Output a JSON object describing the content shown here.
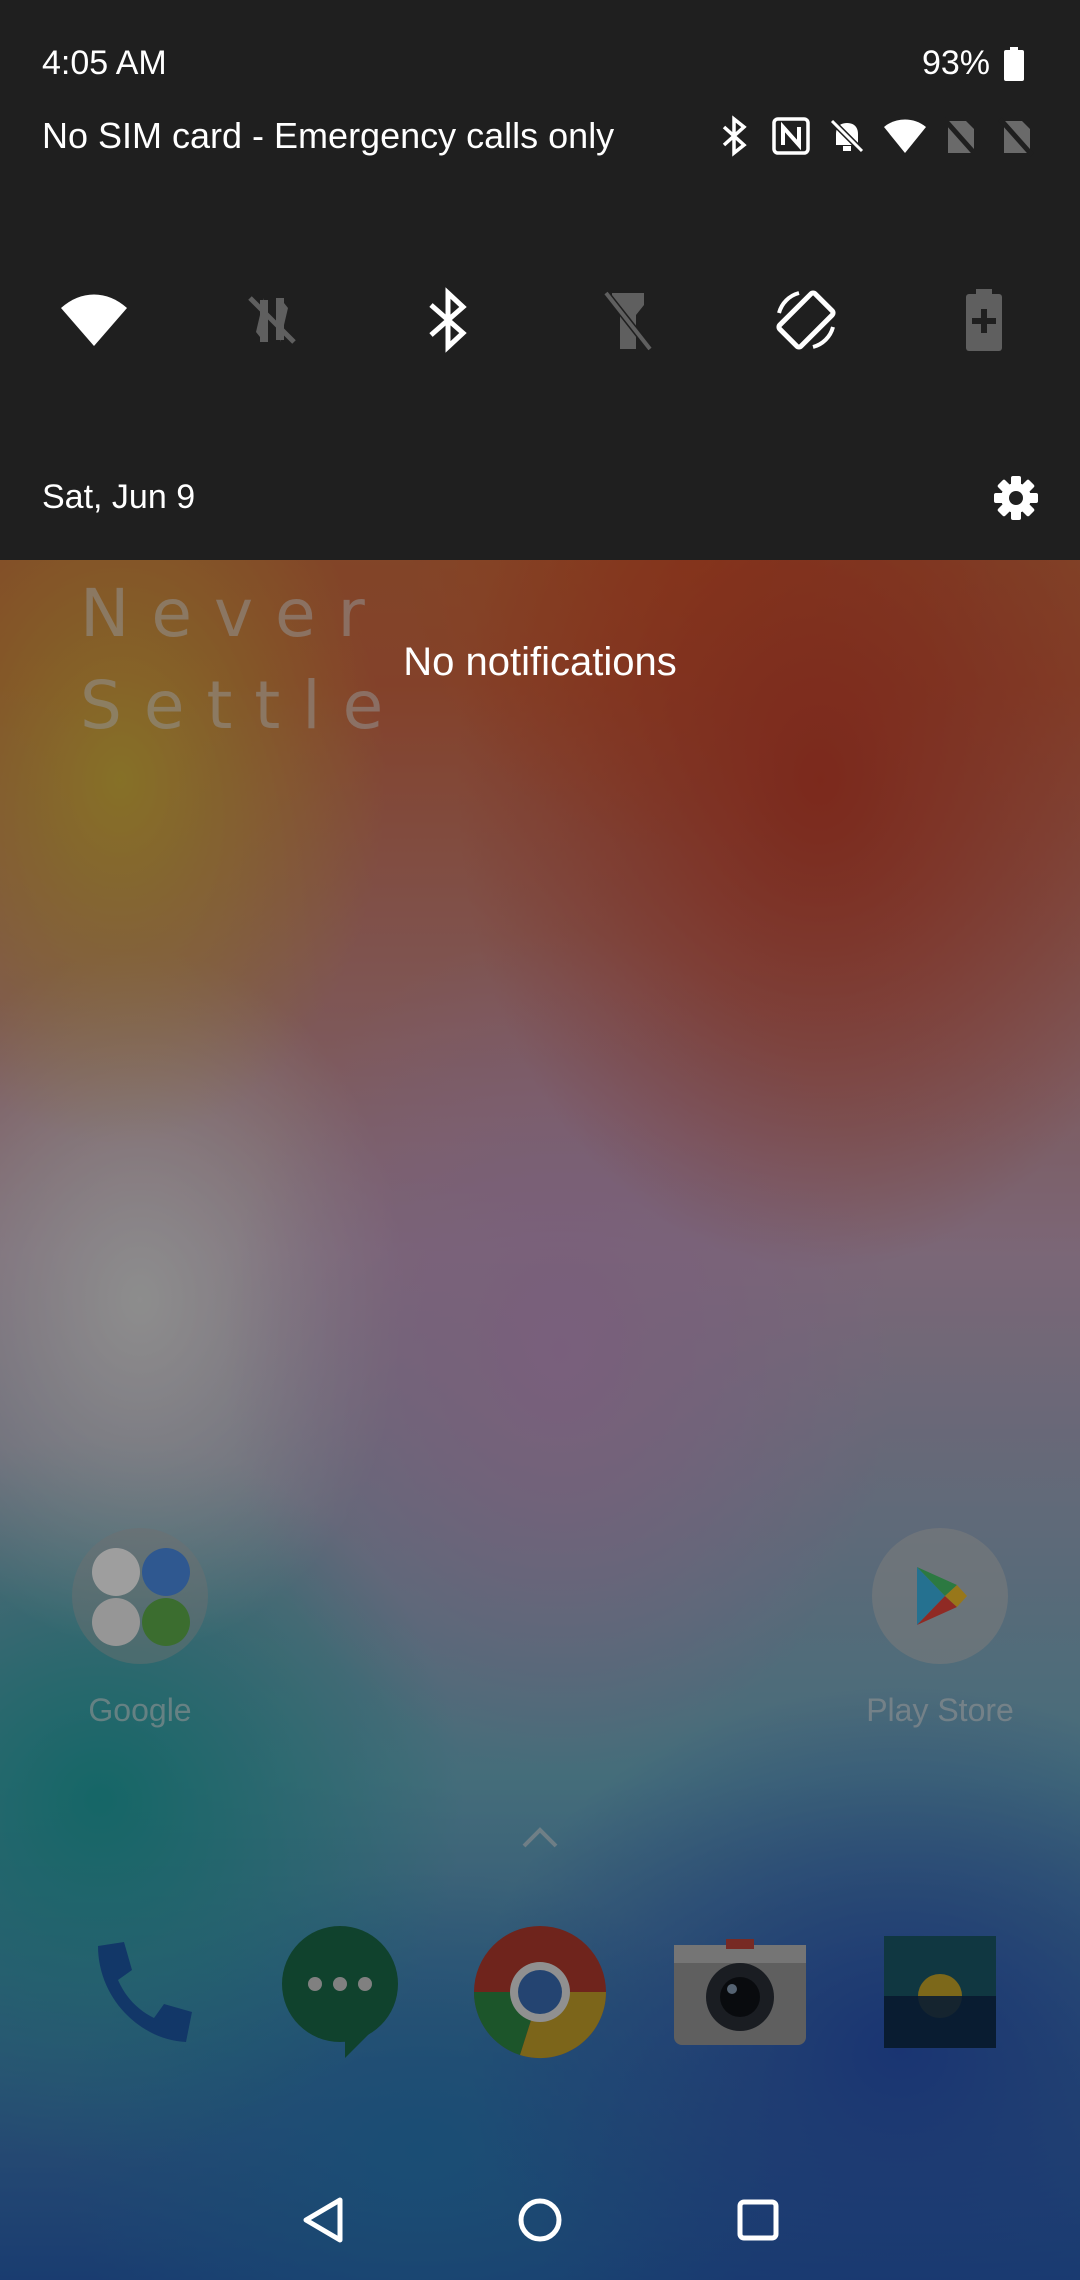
{
  "status_bar": {
    "time": "4:05 AM",
    "battery": "93%",
    "carrier": "No SIM card - Emergency calls only",
    "icons": [
      "bluetooth-icon",
      "nfc-icon",
      "notifications-off-icon",
      "wifi-icon",
      "no-sim-icon",
      "no-sim-icon"
    ]
  },
  "quick_settings": {
    "tiles": [
      {
        "name": "wifi",
        "active": true
      },
      {
        "name": "mobile-data",
        "active": false
      },
      {
        "name": "bluetooth",
        "active": true
      },
      {
        "name": "flashlight",
        "active": false
      },
      {
        "name": "auto-rotate",
        "active": true
      },
      {
        "name": "battery-saver",
        "active": false
      }
    ],
    "date": "Sat, Jun 9"
  },
  "notifications": {
    "empty_text": "No notifications"
  },
  "home": {
    "clock_widget": {
      "line1": "Never",
      "line2": "Settle"
    },
    "apps": [
      {
        "label": "Google",
        "type": "folder"
      },
      {
        "label": "Play Store",
        "type": "app"
      }
    ],
    "dock": [
      "phone",
      "messages",
      "chrome",
      "camera",
      "gallery"
    ]
  },
  "colors": {
    "panel": "#1f1f1f",
    "active_icon": "#ffffff",
    "inactive_icon": "#5f5f5f"
  }
}
